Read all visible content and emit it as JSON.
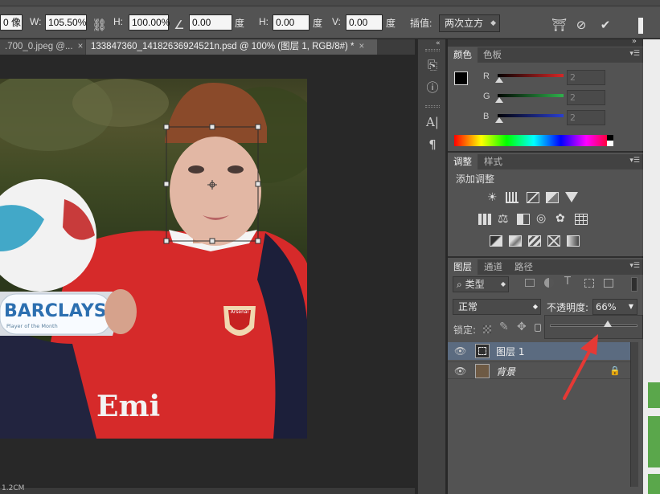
{
  "options_bar": {
    "x_value": "0 像",
    "w_label": "W:",
    "w_value": "105.50%",
    "link_icon": "link-icon",
    "h_label": "H:",
    "h_value": "100.00%",
    "angle_value": "0.00",
    "angle_unit": "度",
    "hskew_label": "H:",
    "hskew_value": "0.00",
    "hskew_unit": "度",
    "vskew_label": "V:",
    "vskew_value": "0.00",
    "vskew_unit": "度",
    "interp_label": "插值:",
    "interp_value": "两次立方"
  },
  "document_tabs": [
    {
      "label": ".700_0.jpeg @...",
      "close": "×"
    },
    {
      "label": "133847360_14182636924521n.psd @ 100% (图层 1, RGB/8#) *",
      "close": "×"
    }
  ],
  "photo": {
    "banner_text": "BARCLAYS",
    "banner_sub": "Player of the Month",
    "shirt_text": "Emi",
    "crest_text": "Arsenal"
  },
  "color_panel": {
    "tabs": [
      "颜色",
      "色板"
    ],
    "sliders": [
      {
        "label": "R",
        "value": "2",
        "color": "#c62a2a"
      },
      {
        "label": "G",
        "value": "2",
        "color": "#2ea84a"
      },
      {
        "label": "B",
        "value": "2",
        "color": "#2b3ec2"
      }
    ]
  },
  "adjustments_panel": {
    "tabs": [
      "调整",
      "样式"
    ],
    "title": "添加调整"
  },
  "layers_panel": {
    "tabs": [
      "图层",
      "通道",
      "路径"
    ],
    "filter_label": "类型",
    "blend_mode": "正常",
    "opacity_label": "不透明度:",
    "opacity_value": "66%",
    "opacity_fraction": 0.66,
    "lock_label": "锁定:",
    "layers": [
      {
        "name": "图层 1",
        "selected": true,
        "locked": false
      },
      {
        "name": "背景",
        "selected": false,
        "locked": true
      }
    ]
  },
  "status_bar": {
    "text": "1.2CM"
  },
  "colors": {
    "ui_bg": "#535353",
    "selected_layer": "#5b6b80",
    "annotation_arrow": "#e53935",
    "shirt_red": "#d62a2a"
  }
}
